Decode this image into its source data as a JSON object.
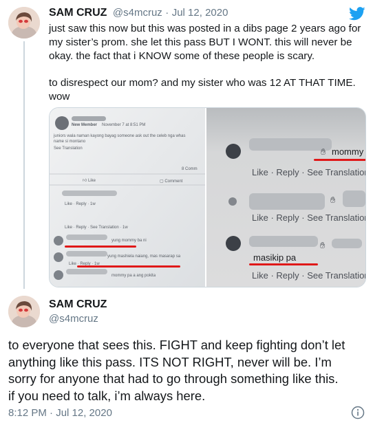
{
  "tweet1": {
    "author_name": "SAM CRUZ",
    "author_handle": "@s4mcruz",
    "separator": "·",
    "date": "Jul 12, 2020",
    "text_lines": [
      "just saw this now but this was posted in a dibs page 2 years ago for",
      "my sister’s prom. she let this pass BUT I WONT. this will never be",
      "okay. the fact that i KNOW some of these people is scary.",
      "",
      "to disrespect our mom? and my sister who was 12 AT THAT TIME.",
      "wow"
    ],
    "photo_left": {
      "new_member": "New Member",
      "post_date": "November 7 at 8:51 PM",
      "post_text_line1": "juniors wala naman kayong bayag someone ask out the celeb nga whas",
      "post_text_line2": "name si montano",
      "see_translation": "See Translation",
      "comments_count": "8 Comm",
      "like_label": "Like",
      "comment_label": "Comment",
      "row1": "Like · Reply · 1w",
      "row2": "Like · Reply · See Translation · 1w",
      "c1": "yung mommy ba ni",
      "c2": "yung mashiela naiang, mas masarap sa",
      "c3": "Like · Reply · 1w",
      "c4": "mommy pa a ang pokita"
    },
    "photo_right": {
      "c1_text": "mommy",
      "c2_text": "masikip pa",
      "action_row": "Like · Reply · See Translation"
    }
  },
  "tweet2": {
    "author_name": "SAM CRUZ",
    "author_handle": "@s4mcruz",
    "text_lines": [
      "to everyone that sees this. FIGHT and keep fighting don’t let",
      "anything like this pass. ITS NOT RIGHT, never will be. I’m",
      "sorry for anyone that had to go through something like this.",
      "if you need to talk, i’m always here."
    ],
    "timestamp": "8:12 PM · Jul 12, 2020"
  },
  "colors": {
    "twitter_blue": "#1da1f2",
    "secondary_text": "#657786",
    "thread_line": "#ccd6dd",
    "underline_red": "#e01818"
  },
  "icons": [
    "twitter-bird-icon",
    "info-icon",
    "hand-emoji-icon",
    "like-thumb-icon",
    "comment-icon"
  ]
}
